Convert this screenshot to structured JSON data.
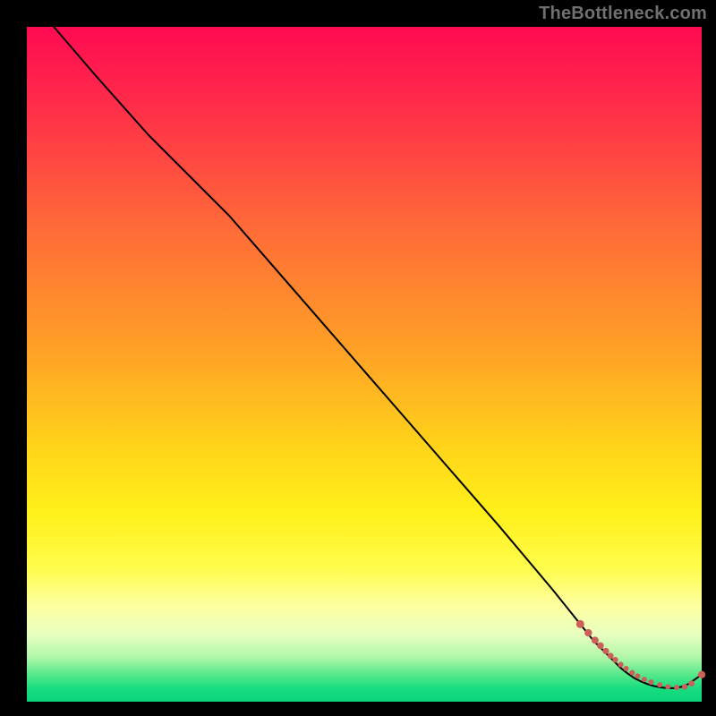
{
  "watermark": "TheBottleneck.com",
  "chart_data": {
    "type": "line",
    "title": "",
    "xlabel": "",
    "ylabel": "",
    "xlim": [
      0,
      100
    ],
    "ylim": [
      0,
      100
    ],
    "grid": false,
    "legend": false,
    "series": [
      {
        "name": "bottleneck-curve",
        "color": "#000000",
        "x": [
          4,
          10,
          18,
          24,
          27,
          30,
          40,
          50,
          60,
          70,
          78,
          82,
          84,
          86,
          87,
          88,
          89,
          90,
          91,
          92,
          93,
          94,
          95,
          96,
          97,
          98,
          100
        ],
        "y": [
          100,
          93,
          84,
          78,
          75,
          72,
          60.5,
          49,
          37.5,
          26,
          16.5,
          11.5,
          9,
          7,
          6,
          5,
          4.2,
          3.5,
          3,
          2.6,
          2.3,
          2.1,
          2,
          2,
          2.2,
          2.6,
          4
        ]
      }
    ],
    "markers": {
      "name": "highlight-dots",
      "color": "#cc5f58",
      "shape": "circle",
      "x": [
        82,
        83.2,
        84.2,
        85,
        85.8,
        86.5,
        87.2,
        88,
        88.8,
        89.7,
        90.5,
        91.5,
        92.5,
        93.8,
        95,
        96.3,
        97.5,
        98.5,
        100
      ],
      "y": [
        11.5,
        10.2,
        9.1,
        8.3,
        7.5,
        6.8,
        6.2,
        5.5,
        4.9,
        4.3,
        3.8,
        3.3,
        2.9,
        2.5,
        2.2,
        2.1,
        2.2,
        2.7,
        4
      ],
      "r": [
        4.5,
        4.2,
        4.0,
        3.8,
        3.6,
        3.4,
        3.2,
        3.1,
        3.0,
        3.0,
        3.0,
        3.0,
        3.0,
        3.0,
        3.0,
        3.0,
        3.2,
        3.4,
        4.2
      ]
    }
  }
}
